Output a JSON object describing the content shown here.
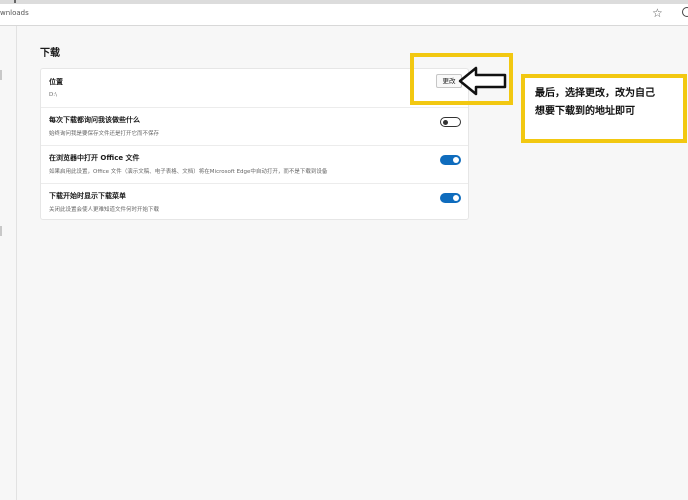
{
  "browser": {
    "url_fragment": "wnloads"
  },
  "page": {
    "title": "下载"
  },
  "settings": {
    "location": {
      "title": "位置",
      "value": "D:\\",
      "button": "更改"
    },
    "ask": {
      "title": "每次下载都询问我该做些什么",
      "desc": "始终询问我是要保存文件还是打开它而不保存",
      "enabled": false
    },
    "office": {
      "title": "在浏览器中打开 Office 文件",
      "desc": "如果启用此设置，Office 文件（演示文稿、电子表格、文档）将在Microsoft Edge中自动打开，而不是下载到设备",
      "enabled": true
    },
    "menu": {
      "title": "下载开始时显示下载菜单",
      "desc": "关闭此设置会使人更难知道文件何时开始下载",
      "enabled": true
    }
  },
  "annotation": {
    "callout_line1": "最后，选择更改，改为自己",
    "callout_line2": "想要下载到的地址即可",
    "highlight_color": "#f2c811"
  }
}
